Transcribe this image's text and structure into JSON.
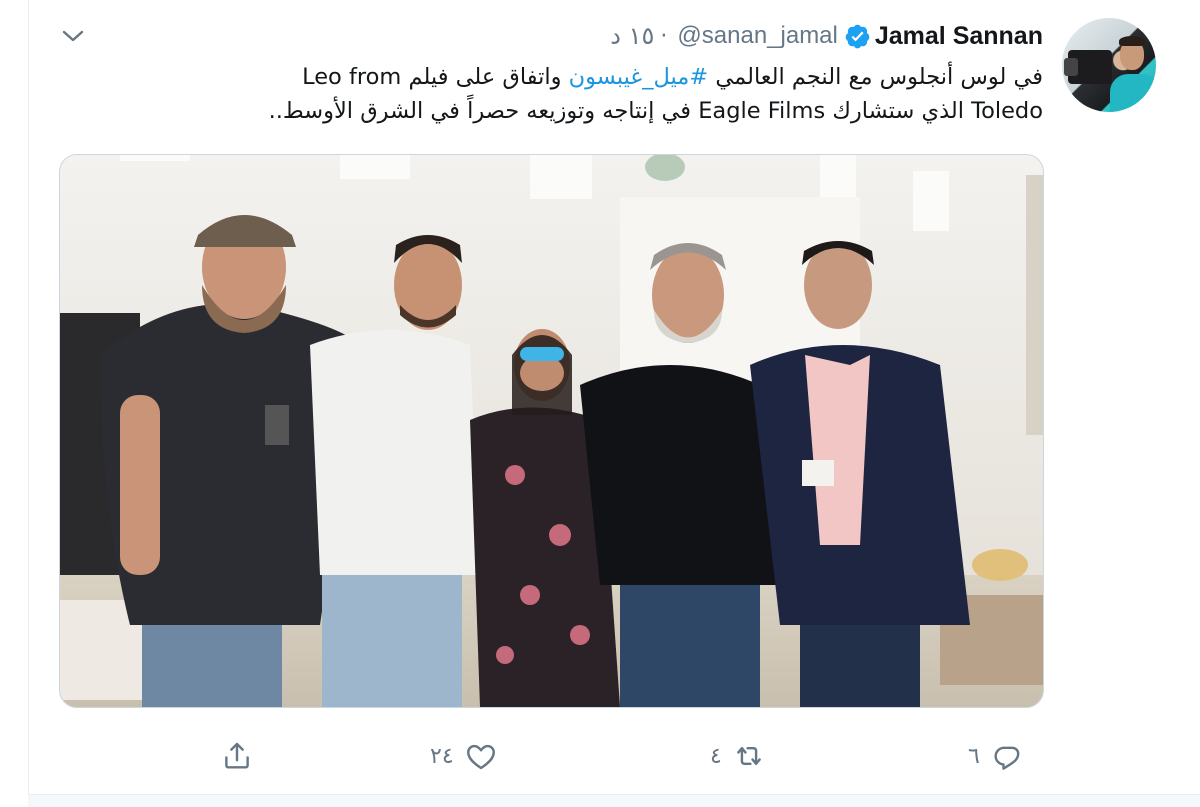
{
  "tweet": {
    "author_name": "Jamal Sannan",
    "handle": "@sanan_jamal",
    "separator": "·",
    "time": "١٥ د",
    "text_line1_before": "في لوس أنجلوس مع النجم العالمي ",
    "hashtag": "#ميل_غيبسون",
    "text_line1_after": " واتفاق على فيلم  Leo from",
    "text_line2": "Toledo الذي ستشارك Eagle Films في إنتاجه وتوزيعه حصراً في الشرق الأوسط.."
  },
  "actions": {
    "reply_count": "٦",
    "retweet_count": "٤",
    "like_count": "٢٤"
  },
  "icons": {
    "verified": "verified-badge-icon",
    "caret": "chevron-down-icon",
    "reply": "reply-icon",
    "retweet": "retweet-icon",
    "like": "heart-icon",
    "share": "share-icon"
  },
  "colors": {
    "accent": "#1b95e0",
    "verified": "#1da1f2",
    "muted": "#657786",
    "text": "#14171a"
  }
}
